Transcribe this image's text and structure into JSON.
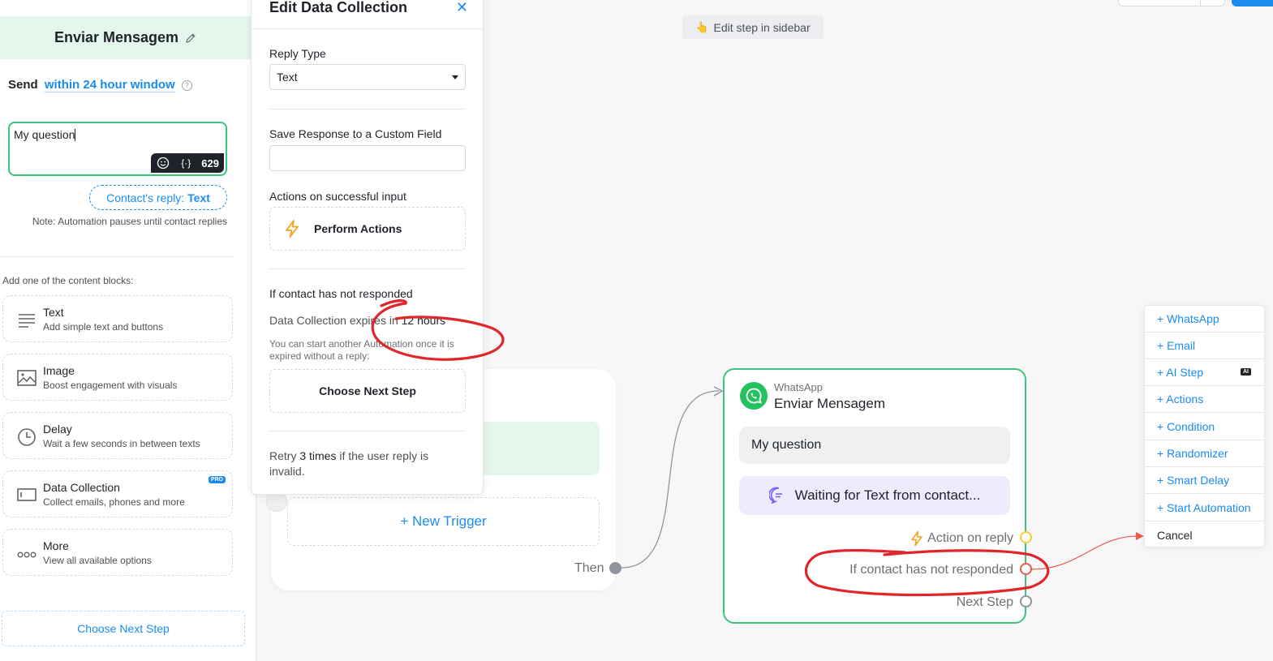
{
  "sidebar": {
    "title": "Enviar Mensagem",
    "send_prefix": "Send",
    "send_window": "within 24 hour window",
    "help_glyph": "?",
    "message_text": "My question",
    "emoji_glyph": "☺",
    "variable_glyph": "{·}",
    "char_count": "629",
    "reply_prefix": "Contact's reply:",
    "reply_type": "Text",
    "note": "Note: Automation pauses until contact replies",
    "blocks_label": "Add one of the content blocks:",
    "blocks": [
      {
        "title": "Text",
        "subtitle": "Add simple text and buttons",
        "icon": "lines-icon"
      },
      {
        "title": "Image",
        "subtitle": "Boost engagement with visuals",
        "icon": "image-icon"
      },
      {
        "title": "Delay",
        "subtitle": "Wait a few seconds in between texts",
        "icon": "clock-icon"
      },
      {
        "title": "Data Collection",
        "subtitle": "Collect emails, phones and more",
        "icon": "form-icon",
        "badge": "PRO"
      },
      {
        "title": "More",
        "subtitle": "View all available options",
        "icon": "dots-icon"
      }
    ],
    "next_step": "Choose Next Step"
  },
  "edit_panel": {
    "title": "Edit Data Collection",
    "close_glyph": "✕",
    "reply_type_label": "Reply Type",
    "reply_type_value": "Text",
    "save_label": "Save Response to a Custom Field",
    "save_value": "",
    "actions_label": "Actions on successful input",
    "perform_actions": "Perform Actions",
    "not_responded_label": "If contact has not responded",
    "expire_prefix": "Data Collection expires in",
    "expire_value": "12 hours",
    "expire_note": "You can start another Automation once it is expired without a reply:",
    "choose_next": "Choose Next Step",
    "retry_prefix": "Retry",
    "retry_value": "3 times",
    "retry_suffix": "if the user reply is invalid."
  },
  "canvas": {
    "hint_glyph": "👆",
    "hint": "Edit step in sidebar",
    "new_trigger": "+ New Trigger",
    "then_label": "Then",
    "node": {
      "kind": "WhatsApp",
      "title": "Enviar Mensagem",
      "question": "My question",
      "waiting": "Waiting for Text from contact...",
      "outputs": {
        "action_on_reply": "Action on reply",
        "not_responded": "If contact has not responded",
        "next_step": "Next Step"
      }
    }
  },
  "step_menu": {
    "items": [
      "+ WhatsApp",
      "+ Email",
      "+ AI Step",
      "+ Actions",
      "+ Condition",
      "+ Randomizer",
      "+ Smart Delay",
      "+ Start Automation"
    ],
    "ai_badge": "AI",
    "cancel": "Cancel"
  },
  "colors": {
    "accent": "#1a8cf0",
    "success": "#3cc47c",
    "whatsapp": "#25c15f",
    "annotation": "#e0262b",
    "action_port": "#f6c83a",
    "not_responded_port": "#ea5a4e"
  }
}
